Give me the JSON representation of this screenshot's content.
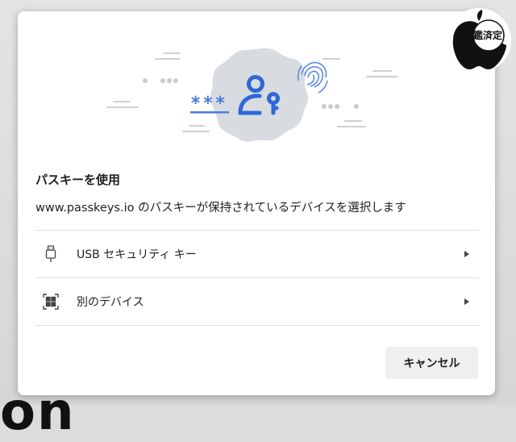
{
  "dialog": {
    "title": "パスキーを使用",
    "subtitle": "www.passkeys.io のパスキーが保持されているデバイスを選択します",
    "options": [
      {
        "label": "USB セキュリティ キー",
        "icon": "usb-key-icon"
      },
      {
        "label": "別のデバイス",
        "icon": "qr-code-icon"
      }
    ],
    "cancel_label": "キャンセル"
  },
  "illustration": {
    "masked_password": "***",
    "accent_color": "#4a7be0",
    "blob_color": "#d8dbe0"
  },
  "badge": {
    "label": "鑑済定",
    "icon": "apple-logo-icon"
  },
  "backdrop": {
    "partial_text": "on"
  }
}
